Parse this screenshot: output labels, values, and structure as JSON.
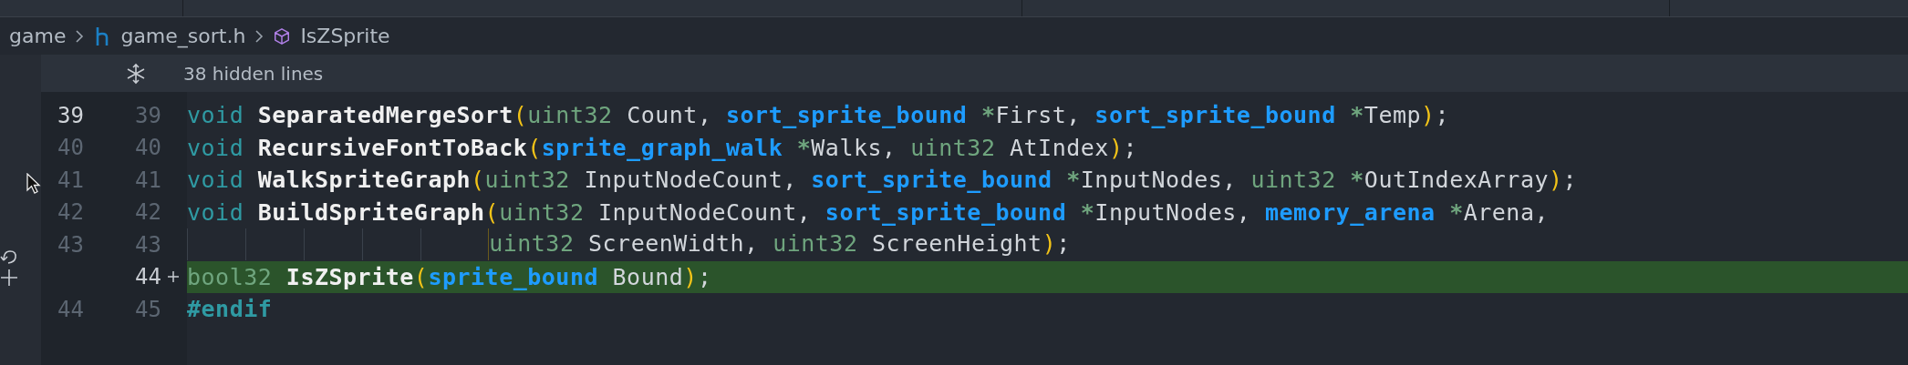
{
  "breadcrumb": [
    {
      "label": "game",
      "kind": "folder"
    },
    {
      "label": "game_sort.h",
      "kind": "file"
    },
    {
      "label": "IsZSprite",
      "kind": "symbol"
    }
  ],
  "hidden_lines": {
    "label": "38 hidden lines"
  },
  "lines": [
    {
      "old": "39",
      "new": "39",
      "current": true,
      "added": false,
      "continuation": false,
      "tokens": [
        {
          "t": "void",
          "kind": "keyword"
        },
        {
          "t": " SeparatedMergeSort",
          "kind": "function"
        },
        {
          "t": "(",
          "kind": "bracket"
        },
        {
          "t": "uint32",
          "kind": "type"
        },
        {
          "t": " Count, ",
          "kind": "plain"
        },
        {
          "t": "sort_sprite_bound",
          "kind": "struct"
        },
        {
          "t": " *",
          "kind": "operator"
        },
        {
          "t": "First, ",
          "kind": "plain"
        },
        {
          "t": "sort_sprite_bound",
          "kind": "struct"
        },
        {
          "t": " *",
          "kind": "operator"
        },
        {
          "t": "Temp",
          "kind": "plain"
        },
        {
          "t": ")",
          "kind": "bracket"
        },
        {
          "t": ";",
          "kind": "plain"
        }
      ]
    },
    {
      "old": "40",
      "new": "40",
      "current": false,
      "added": false,
      "continuation": false,
      "tokens": [
        {
          "t": "void",
          "kind": "keyword"
        },
        {
          "t": " RecursiveFontToBack",
          "kind": "function"
        },
        {
          "t": "(",
          "kind": "bracket"
        },
        {
          "t": "sprite_graph_walk",
          "kind": "struct"
        },
        {
          "t": " *",
          "kind": "operator"
        },
        {
          "t": "Walks, ",
          "kind": "plain"
        },
        {
          "t": "uint32",
          "kind": "type"
        },
        {
          "t": " AtIndex",
          "kind": "plain"
        },
        {
          "t": ")",
          "kind": "bracket"
        },
        {
          "t": ";",
          "kind": "plain"
        }
      ]
    },
    {
      "old": "41",
      "new": "41",
      "current": false,
      "added": false,
      "continuation": false,
      "tokens": [
        {
          "t": "void",
          "kind": "keyword"
        },
        {
          "t": " WalkSpriteGraph",
          "kind": "function"
        },
        {
          "t": "(",
          "kind": "bracket"
        },
        {
          "t": "uint32",
          "kind": "type"
        },
        {
          "t": " InputNodeCount, ",
          "kind": "plain"
        },
        {
          "t": "sort_sprite_bound",
          "kind": "struct"
        },
        {
          "t": " *",
          "kind": "operator"
        },
        {
          "t": "InputNodes, ",
          "kind": "plain"
        },
        {
          "t": "uint32",
          "kind": "type"
        },
        {
          "t": " *",
          "kind": "operator"
        },
        {
          "t": "OutIndexArray",
          "kind": "plain"
        },
        {
          "t": ")",
          "kind": "bracket"
        },
        {
          "t": ";",
          "kind": "plain"
        }
      ]
    },
    {
      "old": "42",
      "new": "42",
      "current": false,
      "added": false,
      "continuation": false,
      "tokens": [
        {
          "t": "void",
          "kind": "keyword"
        },
        {
          "t": " BuildSpriteGraph",
          "kind": "function"
        },
        {
          "t": "(",
          "kind": "bracket"
        },
        {
          "t": "uint32",
          "kind": "type"
        },
        {
          "t": " InputNodeCount, ",
          "kind": "plain"
        },
        {
          "t": "sort_sprite_bound",
          "kind": "struct"
        },
        {
          "t": " *",
          "kind": "operator"
        },
        {
          "t": "InputNodes, ",
          "kind": "plain"
        },
        {
          "t": "memory_arena",
          "kind": "struct"
        },
        {
          "t": " *",
          "kind": "operator"
        },
        {
          "t": "Arena,",
          "kind": "plain"
        }
      ]
    },
    {
      "old": "43",
      "new": "43",
      "current": false,
      "added": false,
      "continuation": true,
      "tokens": [
        {
          "t": "uint32",
          "kind": "type"
        },
        {
          "t": " ScreenWidth, ",
          "kind": "plain"
        },
        {
          "t": "uint32",
          "kind": "type"
        },
        {
          "t": " ScreenHeight",
          "kind": "plain"
        },
        {
          "t": ")",
          "kind": "bracket"
        },
        {
          "t": ";",
          "kind": "plain"
        }
      ]
    },
    {
      "new": "44",
      "added": true,
      "continuation": false,
      "tokens": [
        {
          "t": "bool32",
          "kind": "type"
        },
        {
          "t": " IsZSprite",
          "kind": "function"
        },
        {
          "t": "(",
          "kind": "bracket"
        },
        {
          "t": "sprite_bound",
          "kind": "struct"
        },
        {
          "t": " Bound",
          "kind": "plain"
        },
        {
          "t": ")",
          "kind": "bracket"
        },
        {
          "t": ";",
          "kind": "plain"
        }
      ]
    },
    {
      "old": "44",
      "new": "45",
      "current": false,
      "added": false,
      "continuation": false,
      "tokens": [
        {
          "t": "#endif",
          "kind": "directive"
        }
      ]
    }
  ]
}
